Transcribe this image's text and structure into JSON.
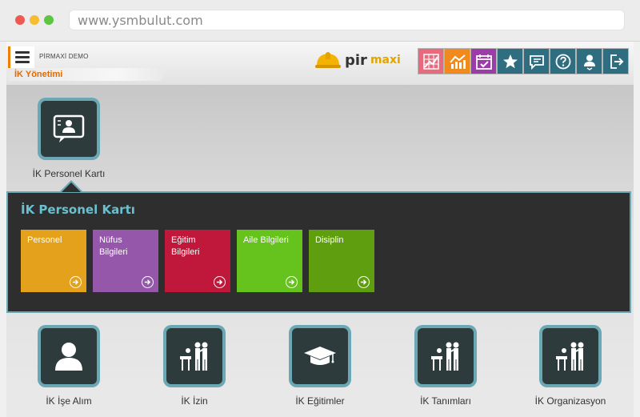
{
  "browser": {
    "url": "www.ysmbulut.com"
  },
  "header": {
    "company": "PİRMAXİ DEMO",
    "module": "İK Yönetimi",
    "logo_pir": "pir",
    "logo_maxi": "maxi"
  },
  "toolbar": [
    {
      "icon": "chart-grid-icon",
      "color": "#e96a7d"
    },
    {
      "icon": "trend-chart-icon",
      "color": "#f08a1c"
    },
    {
      "icon": "calendar-check-icon",
      "color": "#9c3ca8"
    },
    {
      "icon": "star-icon",
      "color": "#2f6e80"
    },
    {
      "icon": "message-icon",
      "color": "#2f6e80"
    },
    {
      "icon": "help-icon",
      "color": "#2f6e80"
    },
    {
      "icon": "user-menu-icon",
      "color": "#2f6e80"
    },
    {
      "icon": "logout-icon",
      "color": "#2f6e80"
    }
  ],
  "top_tile": {
    "label": "İK Personel Kartı"
  },
  "panel": {
    "title": "İK Personel Kartı",
    "items": [
      {
        "label": "Personel",
        "color": "#e4a11b"
      },
      {
        "label": "Nüfus\nBilgileri",
        "color": "#9457a9"
      },
      {
        "label": "Eğitim\nBilgileri",
        "color": "#c0183a"
      },
      {
        "label": "Aile Bilgileri",
        "color": "#66c21c"
      },
      {
        "label": "Disiplin",
        "color": "#5f9f0f"
      }
    ]
  },
  "modules": [
    {
      "label": "İK İşe Alım",
      "icon": "user-icon"
    },
    {
      "label": "İK İzin",
      "icon": "meeting-icon"
    },
    {
      "label": "İK Eğitimler",
      "icon": "graduation-cap-icon"
    },
    {
      "label": "İK Tanımları",
      "icon": "meeting-icon"
    },
    {
      "label": "İK Organizasyon",
      "icon": "meeting-icon"
    }
  ]
}
